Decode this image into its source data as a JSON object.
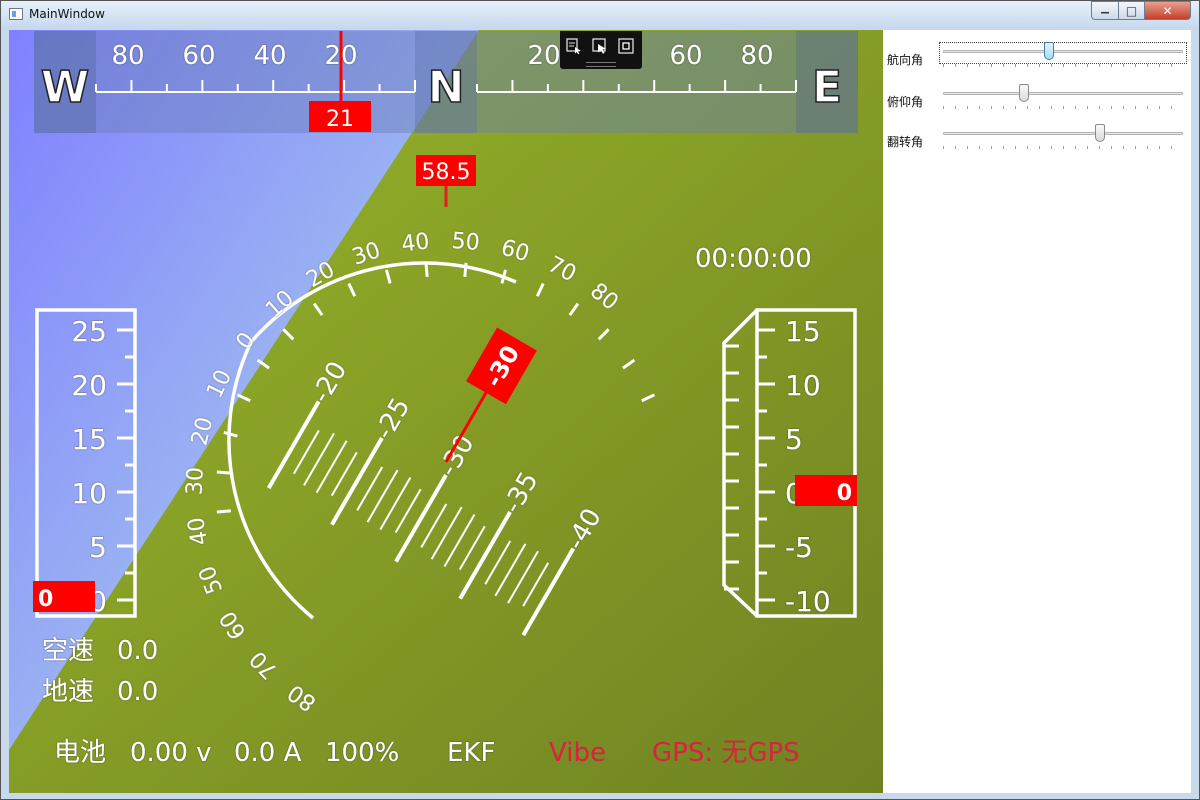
{
  "window": {
    "title": "MainWindow",
    "minimize_symbol": "▁",
    "maximize_symbol": "□",
    "close_symbol": "✕"
  },
  "colors": {
    "sky": "#8a9cf0",
    "ground": "#8fab2a",
    "marker_red": "#ff0000",
    "scale_white": "#ffffff",
    "warn_red": "#dd2040"
  },
  "compass": {
    "cardinal_left": "W",
    "cardinal_center": "N",
    "cardinal_right": "E",
    "left_ticks": [
      "80",
      "60",
      "40",
      "20"
    ],
    "right_ticks": [
      "20",
      "40",
      "60",
      "80"
    ],
    "heading_value": "21"
  },
  "pitch_arc": {
    "top_value": "58.5",
    "labels_left": [
      "10",
      "20",
      "30",
      "40",
      "50",
      "60",
      "70",
      "80"
    ],
    "labels_left_outer": [
      "0",
      "10",
      "20",
      "30",
      "40",
      "50",
      "60",
      "70",
      "80"
    ],
    "labels_top": [
      "10",
      "20",
      "30",
      "40",
      "50",
      "60",
      "70",
      "80"
    ]
  },
  "attitude": {
    "ladder_labels": [
      "-20",
      "-25",
      "-30",
      "-35",
      "-40"
    ],
    "pointer_value": "-30"
  },
  "airspeed_tape": {
    "ticks": [
      "25",
      "20",
      "15",
      "10",
      "5",
      "0"
    ],
    "value": "0"
  },
  "altitude_tape": {
    "ticks": [
      "15",
      "10",
      "5",
      "0",
      "-5",
      "-10"
    ],
    "value": "0"
  },
  "timer": "00:00:00",
  "speeds": {
    "airspeed_label": "空速",
    "airspeed_value": "0.0",
    "groundspeed_label": "地速",
    "groundspeed_value": "0.0"
  },
  "status_bar": {
    "battery_label": "电池",
    "voltage": "0.00 v",
    "current": "0.0 A",
    "percent": "100%",
    "ekf": "EKF",
    "vibe": "Vibe",
    "gps": "GPS: 无GPS"
  },
  "overlay_toolbar": {
    "icons": [
      "select-element-icon",
      "pointer-icon",
      "bounds-icon"
    ]
  },
  "side_panel": {
    "sliders": [
      {
        "label": "航向角",
        "value_fraction": 0.44
      },
      {
        "label": "俯仰角",
        "value_fraction": 0.33
      },
      {
        "label": "翻转角",
        "value_fraction": 0.66
      }
    ]
  }
}
